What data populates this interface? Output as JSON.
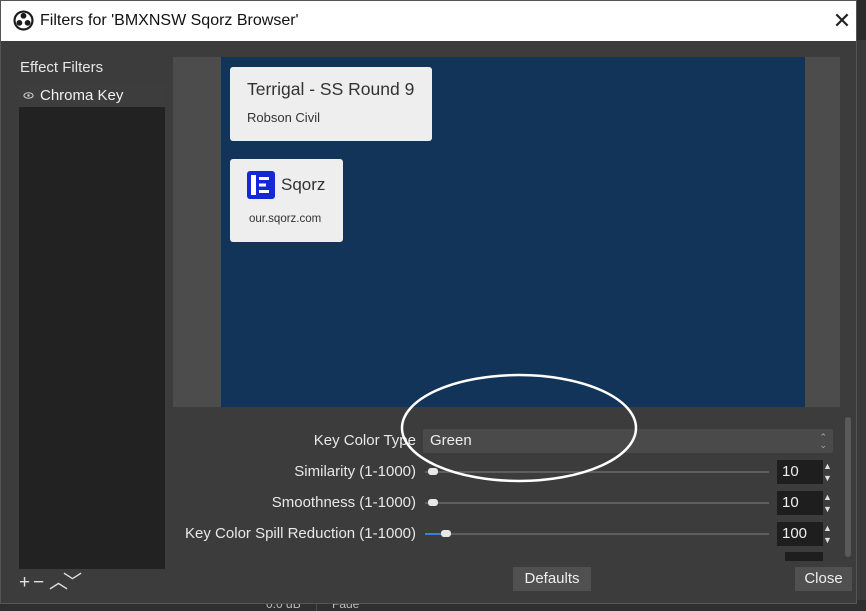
{
  "window": {
    "title": "Filters for 'BMXNSW Sqorz Browser'",
    "close_glyph": "✕"
  },
  "sidebar": {
    "label": "Effect Filters",
    "items": [
      {
        "label": "Chroma Key",
        "visible": true,
        "icon": "eye-icon"
      }
    ],
    "buttons": {
      "add": "+",
      "remove": "−",
      "up": "︿",
      "down": "﹀"
    }
  },
  "preview": {
    "card_event": {
      "title": "Terrigal - SS Round 9",
      "subtitle": "Robson Civil"
    },
    "card_sqorz": {
      "name": "Sqorz",
      "url": "our.sqorz.com"
    },
    "colors": {
      "canvas": "#123458",
      "sqorz_brand": "#1428d8"
    }
  },
  "properties": {
    "key_color_type": {
      "label": "Key Color Type",
      "value": "Green"
    },
    "similarity": {
      "label": "Similarity (1-1000)",
      "value": "10",
      "fraction": 0.01
    },
    "smoothness": {
      "label": "Smoothness (1-1000)",
      "value": "10",
      "fraction": 0.01
    },
    "spill_reduction": {
      "label": "Key Color Spill Reduction (1-1000)",
      "value": "100",
      "fraction": 0.1
    }
  },
  "buttons": {
    "defaults": "Defaults",
    "close": "Close"
  },
  "backdrop": {
    "volume": "0.0 dB",
    "transition": "Fade"
  }
}
